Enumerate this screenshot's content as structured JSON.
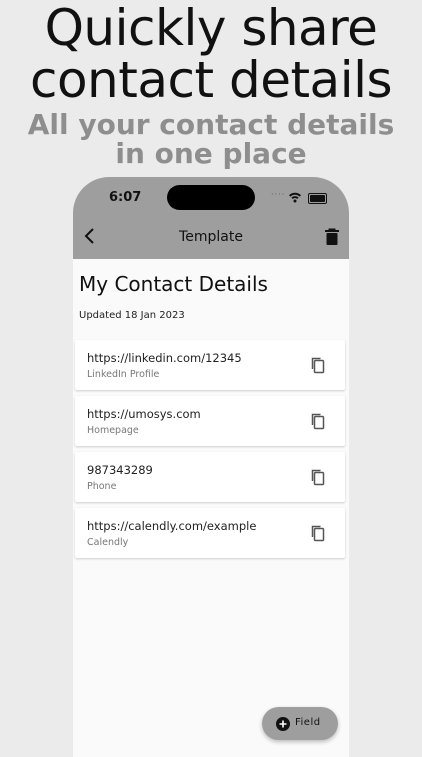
{
  "promo": {
    "headline_line1": "Quickly share",
    "headline_line2": "contact details",
    "subhead_line1": "All your contact details",
    "subhead_line2": "in one place"
  },
  "status_bar": {
    "time": "6:07",
    "signal": "····"
  },
  "app_bar": {
    "title": "Template",
    "back_icon": "chevron-left-icon",
    "delete_icon": "trash-icon"
  },
  "page": {
    "title": "My Contact Details",
    "updated": "Updated 18 Jan 2023"
  },
  "fields": [
    {
      "value": "https://linkedin.com/12345",
      "label": "LinkedIn Profile"
    },
    {
      "value": "https://umosys.com",
      "label": "Homepage"
    },
    {
      "value": "987343289",
      "label": "Phone"
    },
    {
      "value": "https://calendly.com/example",
      "label": "Calendly"
    }
  ],
  "fab": {
    "label": "Field",
    "icon": "plus-circle-icon"
  },
  "colors": {
    "app_bar": "#9e9e9e",
    "background": "#ebebeb",
    "card": "#ffffff",
    "subhead": "#8e8e8e"
  }
}
